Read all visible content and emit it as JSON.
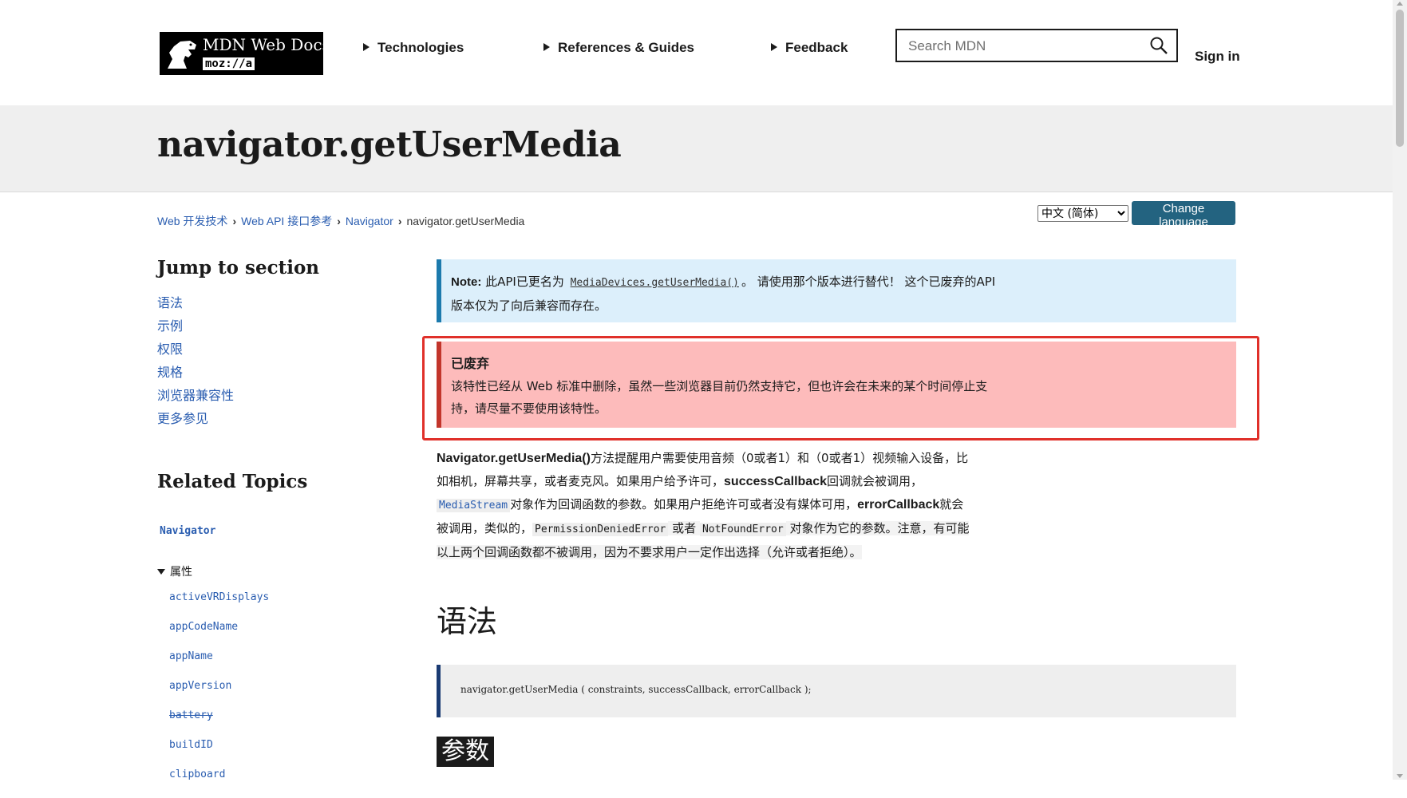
{
  "header": {
    "logo": {
      "title": "MDN Web Docs",
      "subtitle": "moz://a"
    },
    "nav": [
      {
        "label": "Technologies"
      },
      {
        "label": "References & Guides"
      },
      {
        "label": "Feedback"
      }
    ],
    "search": {
      "placeholder": "Search MDN",
      "value": ""
    },
    "sign_in": "Sign in"
  },
  "page": {
    "title": "navigator.getUserMedia"
  },
  "breadcrumbs": [
    {
      "label": "Web 开发技术"
    },
    {
      "label": "Web API 接口参考"
    },
    {
      "label": "Navigator"
    },
    {
      "label": "navigator.getUserMedia"
    }
  ],
  "language": {
    "selected": "中文 (简体)",
    "button": "Change language"
  },
  "sidebar": {
    "jump_heading": "Jump to section",
    "jump_items": [
      "语法",
      "示例",
      "权限",
      "规格",
      "浏览器兼容性",
      "更多参见"
    ],
    "related_heading": "Related Topics",
    "related_root": "Navigator",
    "properties_label": "属性",
    "properties": [
      {
        "name": "activeVRDisplays",
        "deprecated": false
      },
      {
        "name": "appCodeName",
        "deprecated": false
      },
      {
        "name": "appName",
        "deprecated": false
      },
      {
        "name": "appVersion",
        "deprecated": false
      },
      {
        "name": "battery",
        "deprecated": true
      },
      {
        "name": "buildID",
        "deprecated": false
      },
      {
        "name": "clipboard",
        "deprecated": false
      }
    ]
  },
  "note": {
    "label": "Note:",
    "text1": " 此API已更名为 ",
    "link": "MediaDevices.getUserMedia()",
    "text2": "。 请使用那个版本进行替代！ 这个已废弃的API版本仅为了向后兼容而存在。"
  },
  "deprecated": {
    "heading": "已废弃",
    "body": "该特性已经从 Web 标准中删除，虽然一些浏览器目前仍然支持它，但也许会在未来的某个时间停止支持，请尽量不要使用该特性。"
  },
  "description": {
    "p1_bold": "Navigator.getUserMedia()",
    "p1": "方法提醒用户需要使用音频（0或者1）和（0或者1）视频输入设备，比如相机，屏幕共享，或者麦克风。如果用户给予许可，",
    "p2_bold": "successCallback",
    "p2": "回调就会被调用，",
    "p3_code": "MediaStream",
    "p3": "对象作为回调函数的参数。如果用户拒绝许可或者没有媒体可用，",
    "p4_bold": "errorCallback",
    "p4": "就会被调用，类似的，",
    "p5_code": "PermissionDeniedError",
    "p5": " 或者 ",
    "p6_code": "NotFoundError",
    "p6": " 对象作为它的参数。注意，有可能以上两个回调函数都不被调用，因为不要求用户一定作出选择（允许或者拒绝）。"
  },
  "sections": {
    "syntax": "语法",
    "syntax_code": "navigator.getUserMedia ( constraints, successCallback, errorCallback );",
    "params": "参数"
  },
  "colors": {
    "link": "#2a5db0",
    "note_bg": "#dceffb",
    "note_border": "#1c7aad",
    "deprecated_bg": "#fdbbbb",
    "deprecated_border": "#c2352b",
    "highlight_box": "#e0302a",
    "button_bg": "#236380"
  }
}
